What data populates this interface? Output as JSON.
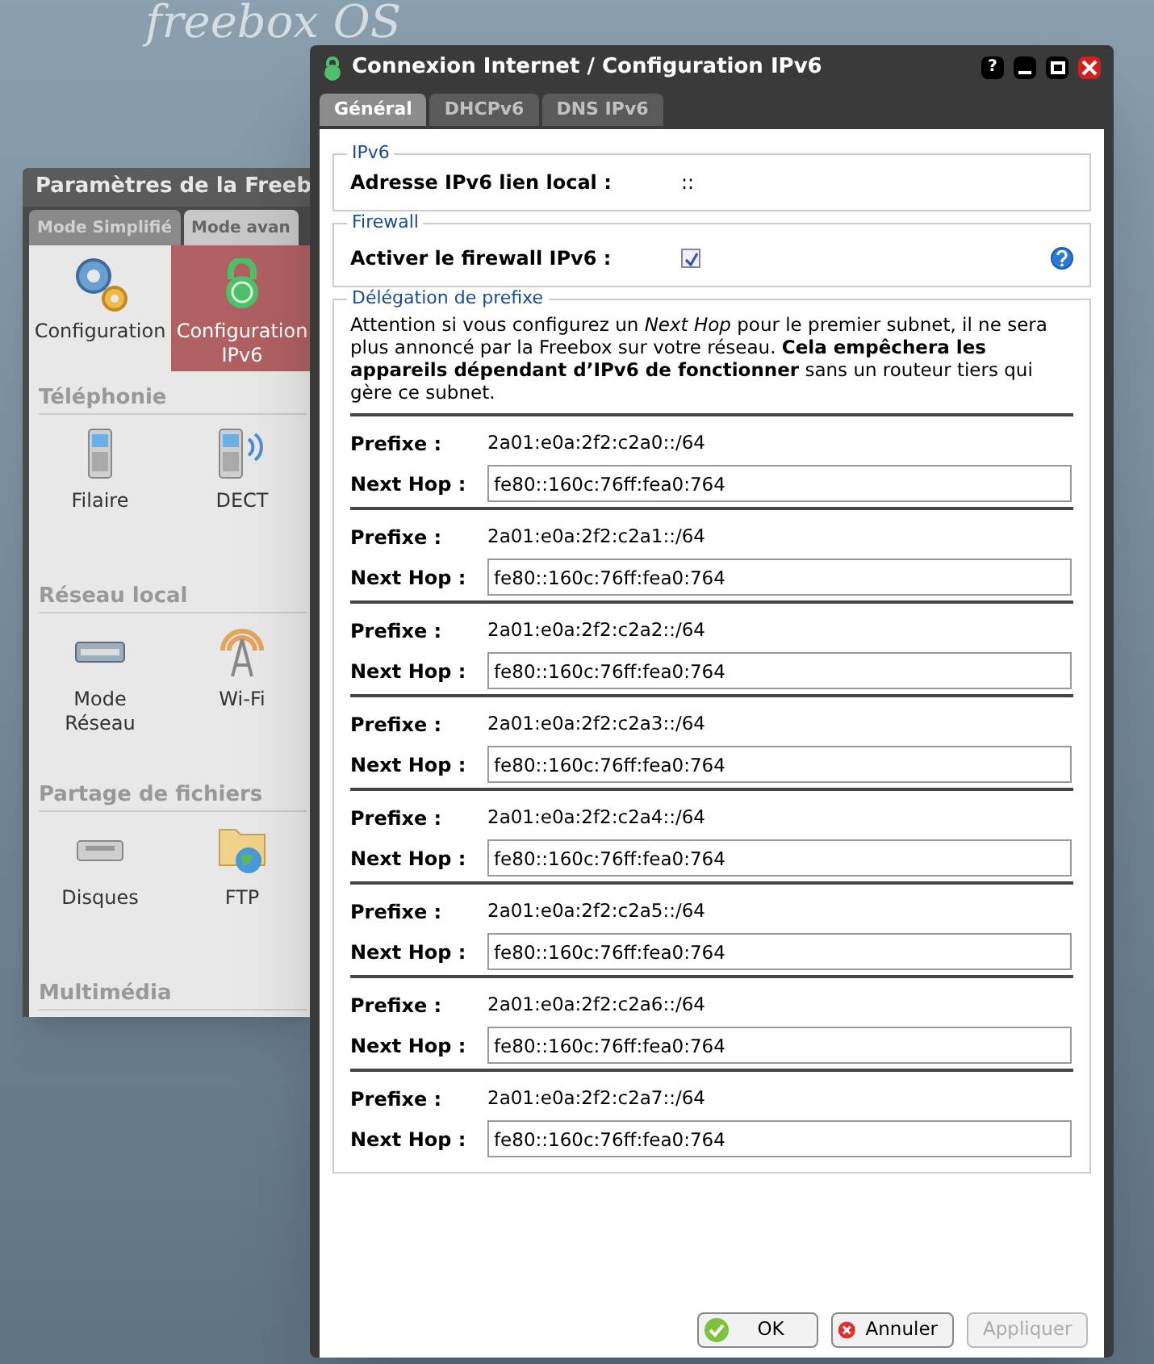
{
  "background_logo": "freebox OS",
  "settings_window": {
    "title": "Paramètres de la Freeb",
    "tabs": [
      {
        "label": "Mode Simplifié",
        "selected": false
      },
      {
        "label": "Mode avan",
        "selected": true
      }
    ],
    "sections": [
      {
        "items": [
          {
            "label": "Configuration",
            "selected": false
          },
          {
            "label": "Configuration IPv6",
            "selected": true
          }
        ]
      },
      {
        "heading": "Téléphonie",
        "items": [
          {
            "label": "Filaire",
            "selected": false
          },
          {
            "label": "DECT",
            "selected": false
          }
        ]
      },
      {
        "heading": "Réseau local",
        "items": [
          {
            "label": "Mode Réseau",
            "selected": false
          },
          {
            "label": "Wi-Fi",
            "selected": false
          }
        ]
      },
      {
        "heading": "Partage de fichiers",
        "items": [
          {
            "label": "Disques",
            "selected": false
          },
          {
            "label": "FTP",
            "selected": false
          }
        ]
      },
      {
        "heading": "Multimédia"
      }
    ]
  },
  "dialog": {
    "title": "Connexion Internet / Configuration IPv6",
    "window_buttons": [
      "?"
    ],
    "tabs": [
      {
        "label": "Général",
        "selected": true
      },
      {
        "label": "DHCPv6",
        "selected": false
      },
      {
        "label": "DNS IPv6",
        "selected": false
      }
    ],
    "ipv6": {
      "legend": "IPv6",
      "label": "Adresse IPv6 lien local :",
      "value": "::"
    },
    "firewall": {
      "legend": "Firewall",
      "label": "Activer le firewall IPv6 :",
      "checked": true
    },
    "delegation": {
      "legend": "Délégation de prefixe",
      "notice": "Attention si vous configurez un *Next Hop* pour le premier subnet, il ne sera plus annoncé par la Freebox sur votre réseau. **Cela empêchera les appareils dépendant d’IPv6 de fonctionner** sans un routeur tiers qui gère ce subnet.",
      "rows": [
        {
          "prefix_label": "Prefixe :",
          "prefix": "2a01:e0a:2f2:c2a0::/64",
          "hop_label": "Next Hop :",
          "hop": "fe80::160c:76ff:fea0:764"
        },
        {
          "prefix_label": "Prefixe :",
          "prefix": "2a01:e0a:2f2:c2a1::/64",
          "hop_label": "Next Hop :",
          "hop": "fe80::160c:76ff:fea0:764"
        },
        {
          "prefix_label": "Prefixe :",
          "prefix": "2a01:e0a:2f2:c2a2::/64",
          "hop_label": "Next Hop :",
          "hop": "fe80::160c:76ff:fea0:764"
        },
        {
          "prefix_label": "Prefixe :",
          "prefix": "2a01:e0a:2f2:c2a3::/64",
          "hop_label": "Next Hop :",
          "hop": "fe80::160c:76ff:fea0:764"
        },
        {
          "prefix_label": "Prefixe :",
          "prefix": "2a01:e0a:2f2:c2a4::/64",
          "hop_label": "Next Hop :",
          "hop": "fe80::160c:76ff:fea0:764"
        },
        {
          "prefix_label": "Prefixe :",
          "prefix": "2a01:e0a:2f2:c2a5::/64",
          "hop_label": "Next Hop :",
          "hop": "fe80::160c:76ff:fea0:764"
        },
        {
          "prefix_label": "Prefixe :",
          "prefix": "2a01:e0a:2f2:c2a6::/64",
          "hop_label": "Next Hop :",
          "hop": "fe80::160c:76ff:fea0:764"
        },
        {
          "prefix_label": "Prefixe :",
          "prefix": "2a01:e0a:2f2:c2a7::/64",
          "hop_label": "Next Hop :",
          "hop": "fe80::160c:76ff:fea0:764"
        }
      ]
    },
    "buttons": [
      {
        "label": "OK",
        "kind": "ok",
        "disabled": false
      },
      {
        "label": "Annuler",
        "kind": "cancel",
        "disabled": false
      },
      {
        "label": "Appliquer",
        "kind": "apply",
        "disabled": true
      }
    ]
  }
}
